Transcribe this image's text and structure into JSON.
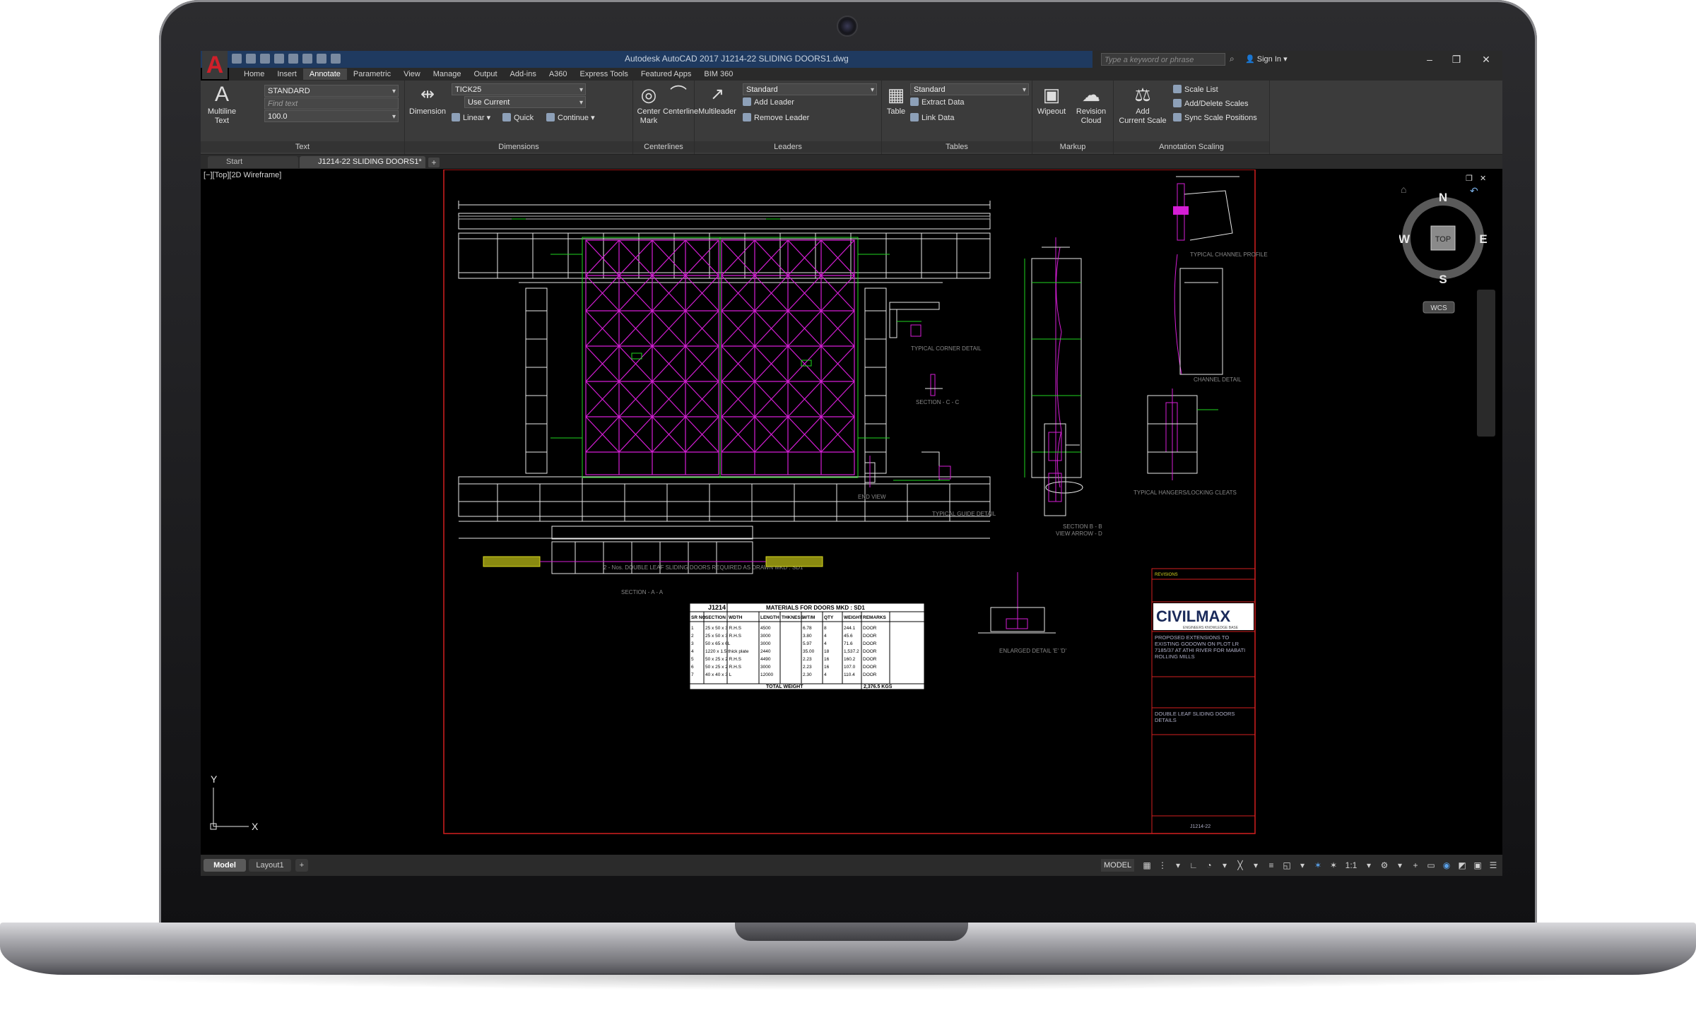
{
  "app": {
    "title": "Autodesk AutoCAD 2017    J1214-22 SLIDING DOORS1.dwg",
    "logo_letter": "A",
    "search_placeholder": "Type a keyword or phrase",
    "sign_in": "Sign In"
  },
  "menu_tabs": [
    "Home",
    "Insert",
    "Annotate",
    "Parametric",
    "View",
    "Manage",
    "Output",
    "Add-ins",
    "A360",
    "Express Tools",
    "Featured Apps",
    "BIM 360"
  ],
  "active_tab": "Annotate",
  "ribbon": {
    "text": {
      "multiline_text": "Multiline\nText",
      "style": "STANDARD",
      "find_placeholder": "Find text",
      "height": "100.0",
      "title": "Text"
    },
    "dimensions": {
      "dimension": "Dimension",
      "style": "TICK25",
      "layer": "Use Current",
      "linear": "Linear",
      "quick": "Quick",
      "continue": "Continue",
      "title": "Dimensions"
    },
    "centerlines": {
      "center_mark": "Center\nMark",
      "centerline": "Centerline",
      "title": "Centerlines"
    },
    "leaders": {
      "multileader": "Multileader",
      "style": "Standard",
      "add_leader": "Add Leader",
      "remove_leader": "Remove Leader",
      "title": "Leaders"
    },
    "tables": {
      "table": "Table",
      "style": "Standard",
      "extract_data": "Extract Data",
      "link_data": "Link Data",
      "title": "Tables"
    },
    "markup": {
      "wipeout": "Wipeout",
      "revision_cloud": "Revision\nCloud",
      "title": "Markup"
    },
    "annotation_scaling": {
      "add_current_scale": "Add\nCurrent Scale",
      "scale_list": "Scale List",
      "add_delete_scales": "Add/Delete Scales",
      "sync_scale_positions": "Sync Scale Positions",
      "title": "Annotation Scaling"
    }
  },
  "doc_tabs": [
    "Start",
    "J1214-22 SLIDING DOORS1*"
  ],
  "viewport": {
    "label": "[−][Top][2D Wireframe]",
    "viewcube": {
      "n": "N",
      "s": "S",
      "e": "E",
      "w": "W",
      "top": "TOP",
      "wcs": "WCS"
    },
    "ucs": {
      "x": "X",
      "y": "Y"
    }
  },
  "drawing": {
    "labels": {
      "elevation": "2 - Nos. DOUBLE LEAF SLIDING DOORS REQUIRED AS DRAWN MKD : SD1",
      "corner": "TYPICAL CORNER DETAIL",
      "section_cc": "SECTION - C - C",
      "channel": "TYPICAL CHANNEL PROFILE",
      "channel_detail": "CHANNEL DETAIL",
      "section_bb": "SECTION B - B",
      "hangers": "TYPICAL HANGERS/LOCKING CLEATS",
      "end_view": "END VIEW",
      "guide": "TYPICAL GUIDE DETAIL",
      "arrow": "VIEW ARROW - D",
      "section_aa": "SECTION - A - A",
      "enlarged": "ENLARGED DETAIL 'E' 'D'"
    },
    "title_block": {
      "logo": "CIVILMAX",
      "tagline": "ENGINEERS KNOWLEDGE BASE",
      "project": "PROPOSED EXTENSIONS TO EXISTING GODOWN ON PLOT LR 7185/37 AT ATHI RIVER FOR MABATI ROLLING MILLS",
      "drawing": "DOUBLE LEAF SLIDING DOORS DETAILS",
      "number": "J1214-22",
      "revisions": "REVISIONS"
    },
    "materials_table": {
      "job": "J1214",
      "title": "MATERIALS FOR DOORS MKD : SD1",
      "headers": [
        "SR NO",
        "SECTION",
        "WDTH",
        "LENGTH",
        "THKNESS",
        "WT/M",
        "QTY",
        "WEIGHT",
        "REMARKS"
      ],
      "rows": [
        [
          "1",
          "25 x 50 x 3 R.H.S",
          "",
          "4500",
          "",
          "6.78",
          "8",
          "244.1",
          "DOOR"
        ],
        [
          "2",
          "25 x 50 x 3 R.H.S",
          "",
          "3000",
          "",
          "3.80",
          "4",
          "45.6",
          "DOOR"
        ],
        [
          "3",
          "50 x 65 x 6L",
          "",
          "3000",
          "",
          "5.97",
          "4",
          "71.6",
          "DOOR"
        ],
        [
          "4",
          "1220 x 1.5 thick plate",
          "",
          "2440",
          "",
          "35.00",
          "18",
          "1,537.2",
          "DOOR"
        ],
        [
          "5",
          "50 x 25 x 2 R.H.S",
          "",
          "4490",
          "",
          "2.23",
          "16",
          "160.2",
          "DOOR"
        ],
        [
          "6",
          "50 x 25 x 2 R.H.S",
          "",
          "3000",
          "",
          "2.23",
          "16",
          "107.0",
          "DOOR"
        ],
        [
          "7",
          "40 x 40 x 3 L",
          "",
          "12000",
          "",
          "2.30",
          "4",
          "110.4",
          "DOOR"
        ]
      ],
      "total_label": "TOTAL WEIGHT",
      "total_value": "2,376.5 KGS"
    }
  },
  "status": {
    "model_tab": "Model",
    "layout_tab": "Layout1",
    "model_button": "MODEL",
    "scale": "1:1"
  }
}
